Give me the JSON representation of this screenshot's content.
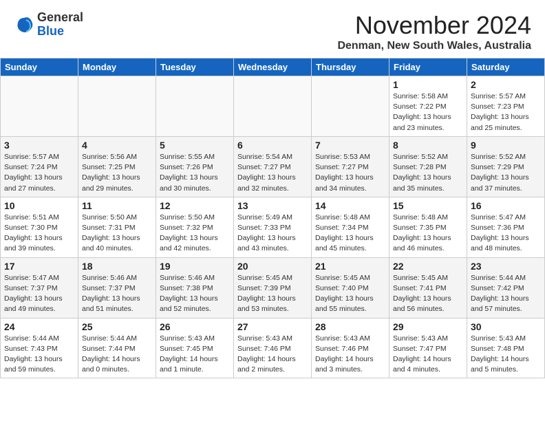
{
  "header": {
    "logo_general": "General",
    "logo_blue": "Blue",
    "month_title": "November 2024",
    "location": "Denman, New South Wales, Australia"
  },
  "weekdays": [
    "Sunday",
    "Monday",
    "Tuesday",
    "Wednesday",
    "Thursday",
    "Friday",
    "Saturday"
  ],
  "weeks": [
    [
      {
        "day": "",
        "info": ""
      },
      {
        "day": "",
        "info": ""
      },
      {
        "day": "",
        "info": ""
      },
      {
        "day": "",
        "info": ""
      },
      {
        "day": "",
        "info": ""
      },
      {
        "day": "1",
        "info": "Sunrise: 5:58 AM\nSunset: 7:22 PM\nDaylight: 13 hours\nand 23 minutes."
      },
      {
        "day": "2",
        "info": "Sunrise: 5:57 AM\nSunset: 7:23 PM\nDaylight: 13 hours\nand 25 minutes."
      }
    ],
    [
      {
        "day": "3",
        "info": "Sunrise: 5:57 AM\nSunset: 7:24 PM\nDaylight: 13 hours\nand 27 minutes."
      },
      {
        "day": "4",
        "info": "Sunrise: 5:56 AM\nSunset: 7:25 PM\nDaylight: 13 hours\nand 29 minutes."
      },
      {
        "day": "5",
        "info": "Sunrise: 5:55 AM\nSunset: 7:26 PM\nDaylight: 13 hours\nand 30 minutes."
      },
      {
        "day": "6",
        "info": "Sunrise: 5:54 AM\nSunset: 7:27 PM\nDaylight: 13 hours\nand 32 minutes."
      },
      {
        "day": "7",
        "info": "Sunrise: 5:53 AM\nSunset: 7:27 PM\nDaylight: 13 hours\nand 34 minutes."
      },
      {
        "day": "8",
        "info": "Sunrise: 5:52 AM\nSunset: 7:28 PM\nDaylight: 13 hours\nand 35 minutes."
      },
      {
        "day": "9",
        "info": "Sunrise: 5:52 AM\nSunset: 7:29 PM\nDaylight: 13 hours\nand 37 minutes."
      }
    ],
    [
      {
        "day": "10",
        "info": "Sunrise: 5:51 AM\nSunset: 7:30 PM\nDaylight: 13 hours\nand 39 minutes."
      },
      {
        "day": "11",
        "info": "Sunrise: 5:50 AM\nSunset: 7:31 PM\nDaylight: 13 hours\nand 40 minutes."
      },
      {
        "day": "12",
        "info": "Sunrise: 5:50 AM\nSunset: 7:32 PM\nDaylight: 13 hours\nand 42 minutes."
      },
      {
        "day": "13",
        "info": "Sunrise: 5:49 AM\nSunset: 7:33 PM\nDaylight: 13 hours\nand 43 minutes."
      },
      {
        "day": "14",
        "info": "Sunrise: 5:48 AM\nSunset: 7:34 PM\nDaylight: 13 hours\nand 45 minutes."
      },
      {
        "day": "15",
        "info": "Sunrise: 5:48 AM\nSunset: 7:35 PM\nDaylight: 13 hours\nand 46 minutes."
      },
      {
        "day": "16",
        "info": "Sunrise: 5:47 AM\nSunset: 7:36 PM\nDaylight: 13 hours\nand 48 minutes."
      }
    ],
    [
      {
        "day": "17",
        "info": "Sunrise: 5:47 AM\nSunset: 7:37 PM\nDaylight: 13 hours\nand 49 minutes."
      },
      {
        "day": "18",
        "info": "Sunrise: 5:46 AM\nSunset: 7:37 PM\nDaylight: 13 hours\nand 51 minutes."
      },
      {
        "day": "19",
        "info": "Sunrise: 5:46 AM\nSunset: 7:38 PM\nDaylight: 13 hours\nand 52 minutes."
      },
      {
        "day": "20",
        "info": "Sunrise: 5:45 AM\nSunset: 7:39 PM\nDaylight: 13 hours\nand 53 minutes."
      },
      {
        "day": "21",
        "info": "Sunrise: 5:45 AM\nSunset: 7:40 PM\nDaylight: 13 hours\nand 55 minutes."
      },
      {
        "day": "22",
        "info": "Sunrise: 5:45 AM\nSunset: 7:41 PM\nDaylight: 13 hours\nand 56 minutes."
      },
      {
        "day": "23",
        "info": "Sunrise: 5:44 AM\nSunset: 7:42 PM\nDaylight: 13 hours\nand 57 minutes."
      }
    ],
    [
      {
        "day": "24",
        "info": "Sunrise: 5:44 AM\nSunset: 7:43 PM\nDaylight: 13 hours\nand 59 minutes."
      },
      {
        "day": "25",
        "info": "Sunrise: 5:44 AM\nSunset: 7:44 PM\nDaylight: 14 hours\nand 0 minutes."
      },
      {
        "day": "26",
        "info": "Sunrise: 5:43 AM\nSunset: 7:45 PM\nDaylight: 14 hours\nand 1 minute."
      },
      {
        "day": "27",
        "info": "Sunrise: 5:43 AM\nSunset: 7:46 PM\nDaylight: 14 hours\nand 2 minutes."
      },
      {
        "day": "28",
        "info": "Sunrise: 5:43 AM\nSunset: 7:46 PM\nDaylight: 14 hours\nand 3 minutes."
      },
      {
        "day": "29",
        "info": "Sunrise: 5:43 AM\nSunset: 7:47 PM\nDaylight: 14 hours\nand 4 minutes."
      },
      {
        "day": "30",
        "info": "Sunrise: 5:43 AM\nSunset: 7:48 PM\nDaylight: 14 hours\nand 5 minutes."
      }
    ]
  ]
}
